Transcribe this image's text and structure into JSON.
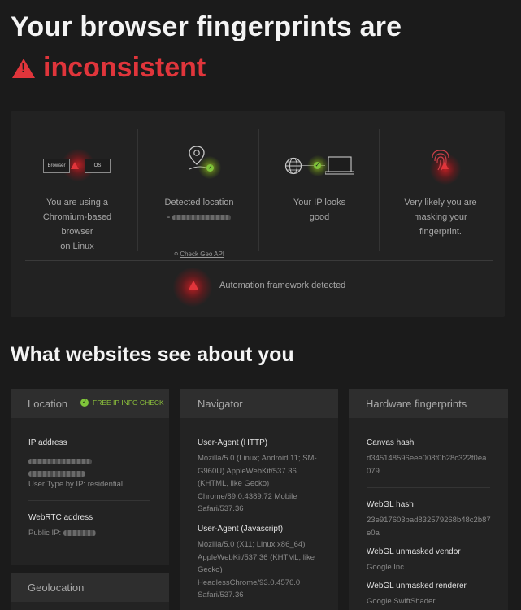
{
  "header": {
    "title_line1": "Your browser fingerprints are",
    "title_line2": "inconsistent"
  },
  "summary": {
    "browser": {
      "chip_left": "Browser",
      "chip_right": "OS",
      "text_lines": [
        "You are using a",
        "Chromium-based",
        "browser",
        "on Linux"
      ]
    },
    "location": {
      "text_line1": "Detected location",
      "text_line2_prefix": "-",
      "link": "Check Geo API"
    },
    "ip": {
      "text_lines": [
        "Your IP looks",
        "good"
      ]
    },
    "fingerprint": {
      "text_lines": [
        "Very likely you are",
        "masking your",
        "fingerprint."
      ]
    },
    "automation": "Automation framework detected"
  },
  "section_title": "What websites see about you",
  "location_panel": {
    "title": "Location",
    "badge": "FREE IP INFO CHECK",
    "ip_label": "IP address",
    "user_type": "User Type by IP: residential",
    "webrtc_label": "WebRTC address",
    "public_ip_prefix": "Public IP:"
  },
  "geolocation_panel": {
    "title": "Geolocation"
  },
  "navigator_panel": {
    "title": "Navigator",
    "ua_http_label": "User-Agent (HTTP)",
    "ua_http_lines": [
      "Mozilla/5.0 (Linux; Android 11; SM-",
      "G960U) AppleWebKit/537.36",
      "(KHTML, like Gecko)",
      "Chrome/89.0.4389.72 Mobile",
      "Safari/537.36"
    ],
    "ua_js_label": "User-Agent (Javascript)",
    "ua_js_lines": [
      "Mozilla/5.0 (X11; Linux x86_64)",
      "AppleWebKit/537.36 (KHTML, like",
      "Gecko)",
      "HeadlessChrome/93.0.4576.0",
      "Safari/537.36"
    ]
  },
  "hardware_panel": {
    "title": "Hardware fingerprints",
    "canvas_label": "Canvas hash",
    "canvas_lines": [
      "d345148596eee008f0b28c322f0ea",
      "079"
    ],
    "webgl_label": "WebGL hash",
    "webgl_lines": [
      "23e917603bad832579268b48c2b87",
      "e0a"
    ],
    "vendor_label": "WebGL unmasked vendor",
    "vendor_value": "Google Inc.",
    "renderer_label": "WebGL unmasked renderer",
    "renderer_value": "Google SwiftShader"
  },
  "colors": {
    "background": "#1b1b1b",
    "danger": "#e0353b",
    "ok": "#7fc43a"
  },
  "icons": [
    "warning-triangle-icon",
    "map-pin-icon",
    "globe-icon",
    "laptop-icon",
    "fingerprint-icon",
    "check-icon"
  ]
}
